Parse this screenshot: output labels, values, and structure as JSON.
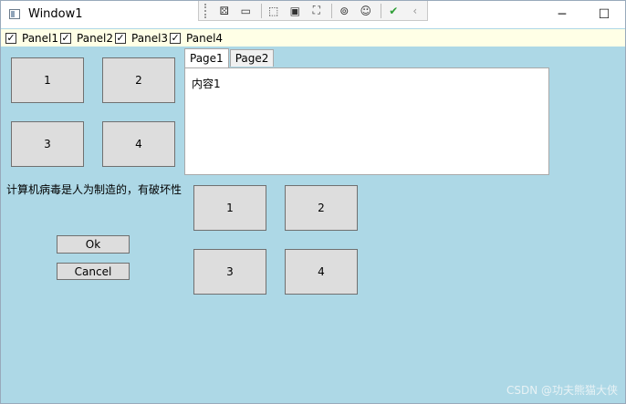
{
  "window": {
    "title": "Window1"
  },
  "titlebar": {
    "minimize_glyph": "─",
    "maximize_glyph": "☐",
    "close_glyph": "✕"
  },
  "devtools": {
    "icons": [
      "live-tree-icon",
      "record-icon",
      "select-element-icon",
      "layout-adorner-icon",
      "track-focus-icon",
      "binding-icon",
      "accessibility-icon",
      "checkmark-icon",
      "collapse-arrow-icon"
    ]
  },
  "checkboxes": [
    {
      "label": "Panel1",
      "checked": true
    },
    {
      "label": "Panel2",
      "checked": true
    },
    {
      "label": "Panel3",
      "checked": true
    },
    {
      "label": "Panel4",
      "checked": true
    }
  ],
  "panel1": {
    "buttons": [
      "1",
      "2",
      "3",
      "4"
    ]
  },
  "tabs": {
    "items": [
      "Page1",
      "Page2"
    ],
    "selected": "Page1",
    "content": "内容1"
  },
  "panel3": {
    "text": "计算机病毒是人为制造的，有破坏性",
    "ok_label": "Ok",
    "cancel_label": "Cancel"
  },
  "panel4": {
    "buttons": [
      "1",
      "2",
      "3",
      "4"
    ]
  },
  "watermark": "CSDN @功夫熊猫大侠"
}
